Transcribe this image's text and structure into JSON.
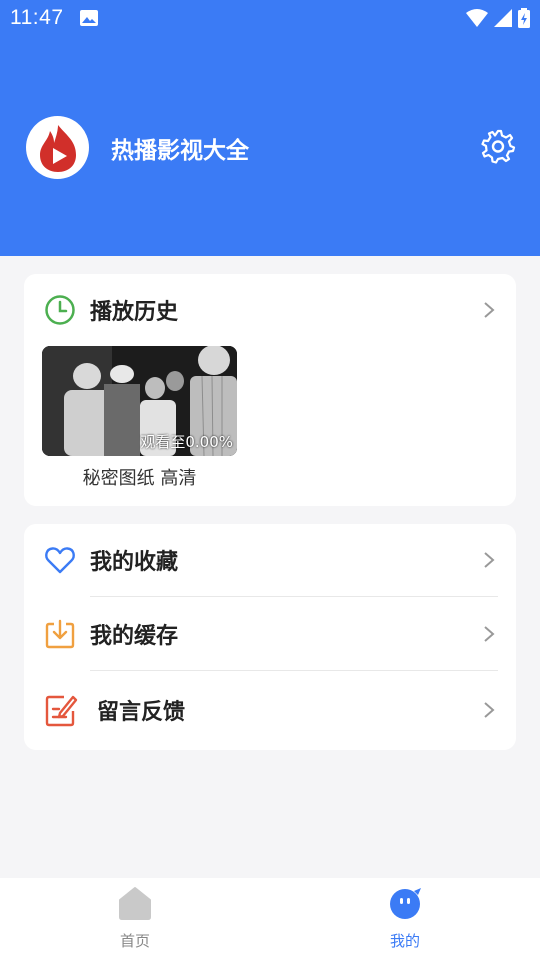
{
  "status_bar": {
    "time": "11:47"
  },
  "header": {
    "app_name": "热播影视大全"
  },
  "history": {
    "title": "播放历史",
    "items": [
      {
        "title": "秘密图纸 高清",
        "progress": "观看至0.00%"
      }
    ]
  },
  "menu": {
    "items": [
      {
        "label": "我的收藏",
        "icon": "heart-icon"
      },
      {
        "label": "我的缓存",
        "icon": "download-icon"
      },
      {
        "label": "留言反馈",
        "icon": "feedback-edit-icon"
      }
    ]
  },
  "tabbar": {
    "tabs": [
      {
        "label": "首页",
        "icon": "home-icon",
        "active": false
      },
      {
        "label": "我的",
        "icon": "mine-face-icon",
        "active": true
      }
    ]
  },
  "colors": {
    "primary": "#3b7bf5",
    "history_icon": "#4caf50",
    "cache_icon": "#f0a040",
    "feedback_icon": "#e4573d"
  }
}
